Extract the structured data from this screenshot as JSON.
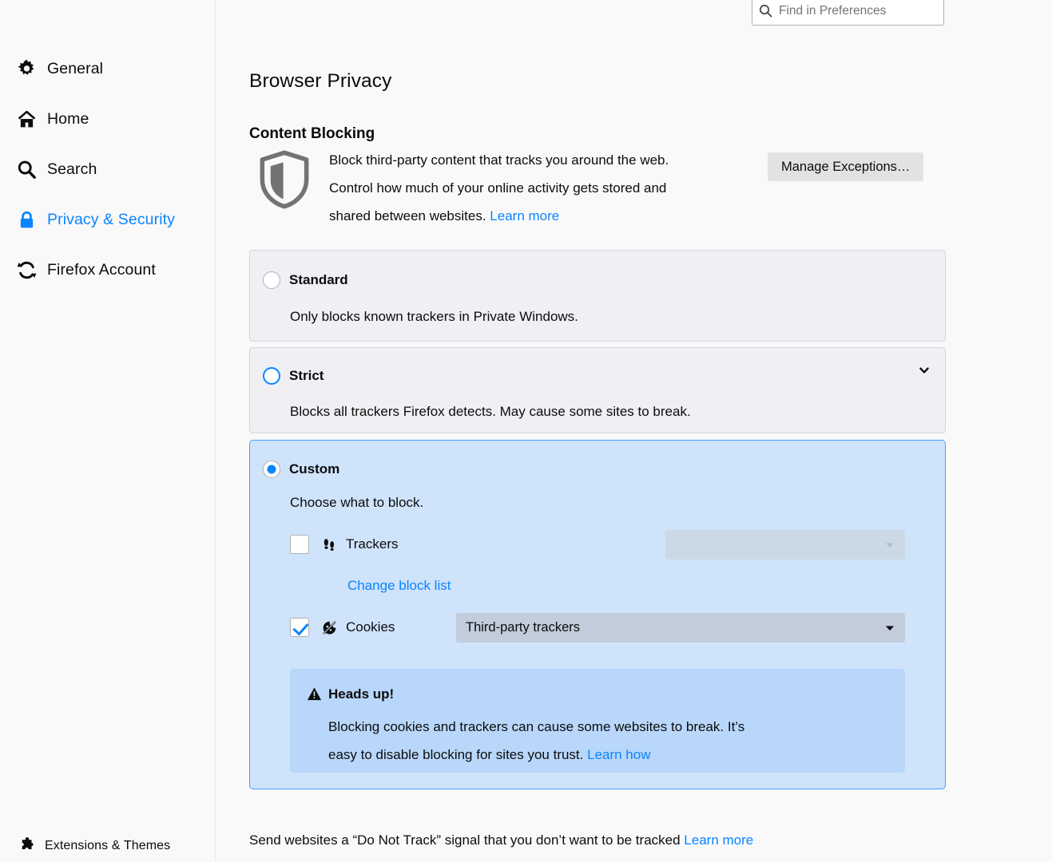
{
  "search": {
    "placeholder": "Find in Preferences",
    "icon": "search-icon"
  },
  "sidebar": {
    "items": [
      {
        "label": "General",
        "icon": "gear-icon",
        "active": false
      },
      {
        "label": "Home",
        "icon": "home-icon",
        "active": false
      },
      {
        "label": "Search",
        "icon": "magnifier-icon",
        "active": false
      },
      {
        "label": "Privacy & Security",
        "icon": "lock-icon",
        "active": true
      },
      {
        "label": "Firefox Account",
        "icon": "sync-refresh-icon",
        "active": false
      }
    ],
    "bottom_item": {
      "label": "Extensions & Themes",
      "icon": "puzzle-piece-icon"
    },
    "active_color": "#0a84ff"
  },
  "main": {
    "page_title": "Browser Privacy",
    "section_title": "Content Blocking",
    "intro": {
      "icon": "shield-icon",
      "line1": "Block third-party content that tracks you around the web.",
      "line2": "Control how much of your online activity gets stored and",
      "line3": "shared between websites. ",
      "learn_more": "Learn more",
      "button_label": "Manage Exceptions…"
    },
    "options": [
      {
        "id": "standard",
        "label": "Standard",
        "description": "Only blocks known trackers in Private Windows.",
        "selected": false,
        "radio_state": "normal",
        "expandable": false
      },
      {
        "id": "strict",
        "label": "Strict",
        "description": "Blocks all trackers Firefox detects. May cause some sites to break.",
        "selected": false,
        "radio_state": "hovered",
        "expandable": true,
        "expand_icon": "chevron-down-icon"
      },
      {
        "id": "custom",
        "label": "Custom",
        "description": "Choose what to block.",
        "selected": true,
        "radio_state": "checked",
        "expandable": false
      }
    ],
    "custom": {
      "trackers": {
        "label": "Trackers",
        "icon": "footprints-icon",
        "checked": false,
        "dropdown_value": "",
        "dropdown_disabled": true,
        "dropdown_arrow": "caret-down-icon",
        "sublink": "Change block list"
      },
      "cookies": {
        "label": "Cookies",
        "icon": "cookie-blocked-icon",
        "checked": true,
        "dropdown_value": "Third-party trackers",
        "dropdown_disabled": false,
        "dropdown_arrow": "caret-down-icon"
      },
      "warning": {
        "icon": "warning-triangle-icon",
        "title": "Heads up!",
        "line1": "Blocking cookies and trackers can cause some websites to break. It’s",
        "line2": "easy to disable blocking for sites you trust. ",
        "learn_how": "Learn how"
      }
    },
    "do_not_track": {
      "text": "Send websites a “Do Not Track” signal that you don’t want to be tracked ",
      "learn_more": "Learn more"
    }
  },
  "colors": {
    "page_bg": "#f9f9fa",
    "card_bg": "#f0f0f4",
    "card_border": "#d7d7db",
    "custom_bg": "#cfe3fb",
    "custom_border": "#45a1ff",
    "warning_bg": "#b9d7fa",
    "accent_blue": "#0a84ff",
    "button_bg": "#e2e2e4",
    "dropdown_bg": "#c2ccda",
    "dropdown_disabled_bg": "#cbd9e7"
  }
}
